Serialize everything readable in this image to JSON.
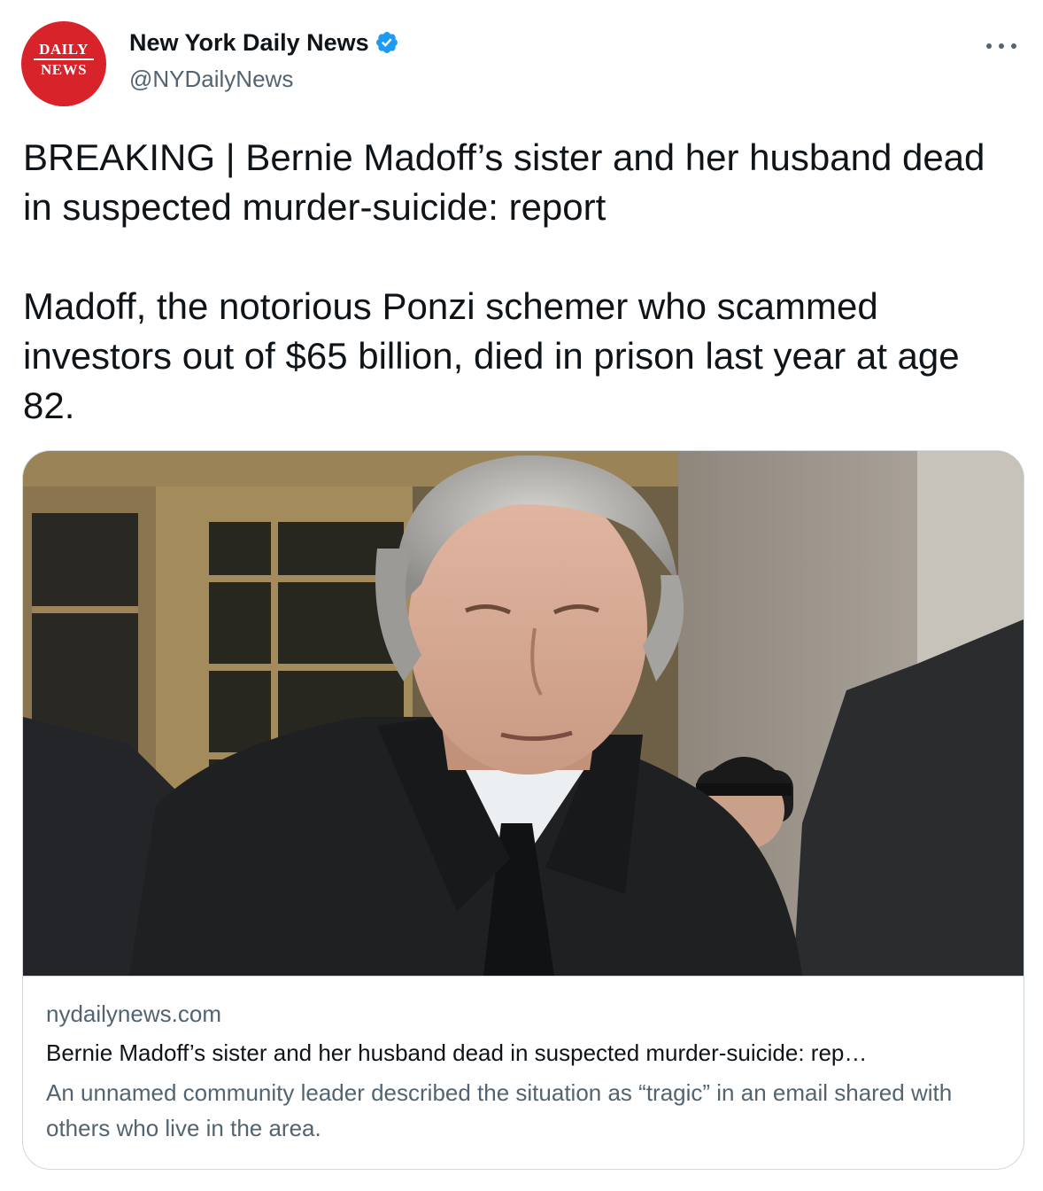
{
  "tweet": {
    "author": {
      "display_name": "New York Daily News",
      "handle": "@NYDailyNews",
      "verified": true,
      "avatar_text": [
        "DAILY",
        "NEWS"
      ],
      "avatar_color": "#d8232a"
    },
    "text": "BREAKING | Bernie Madoff’s sister and her husband dead in suspected murder-suicide: report\n\nMadoff, the notorious Ponzi schemer who scammed investors out of $65 billion, died in prison last year at age 82.",
    "more_icon": "more-horizontal-icon"
  },
  "card": {
    "domain": "nydailynews.com",
    "title": "Bernie Madoff’s sister and her husband dead in suspected murder-suicide: rep…",
    "description": "An unnamed community leader described the situation as “tragic” in an email shared with others who live in the area."
  },
  "colors": {
    "text_primary": "#0f1419",
    "text_secondary": "#536471",
    "verified_blue": "#1d9bf0",
    "border": "#cfd9de"
  }
}
